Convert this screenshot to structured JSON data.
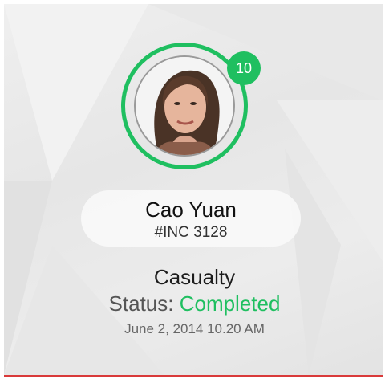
{
  "profile": {
    "name": "Cao Yuan",
    "incident_id": "#INC 3128",
    "badge_count": "10",
    "avatar_icon": "user-avatar-photo"
  },
  "incident": {
    "category": "Casualty",
    "status_label": "Status: ",
    "status_value": "Completed",
    "timestamp": "June 2, 2014 10.20 AM"
  },
  "colors": {
    "accent_green": "#1fbf60",
    "bottom_border_red": "#d93a3a",
    "card_background": "#e9e9e9"
  }
}
